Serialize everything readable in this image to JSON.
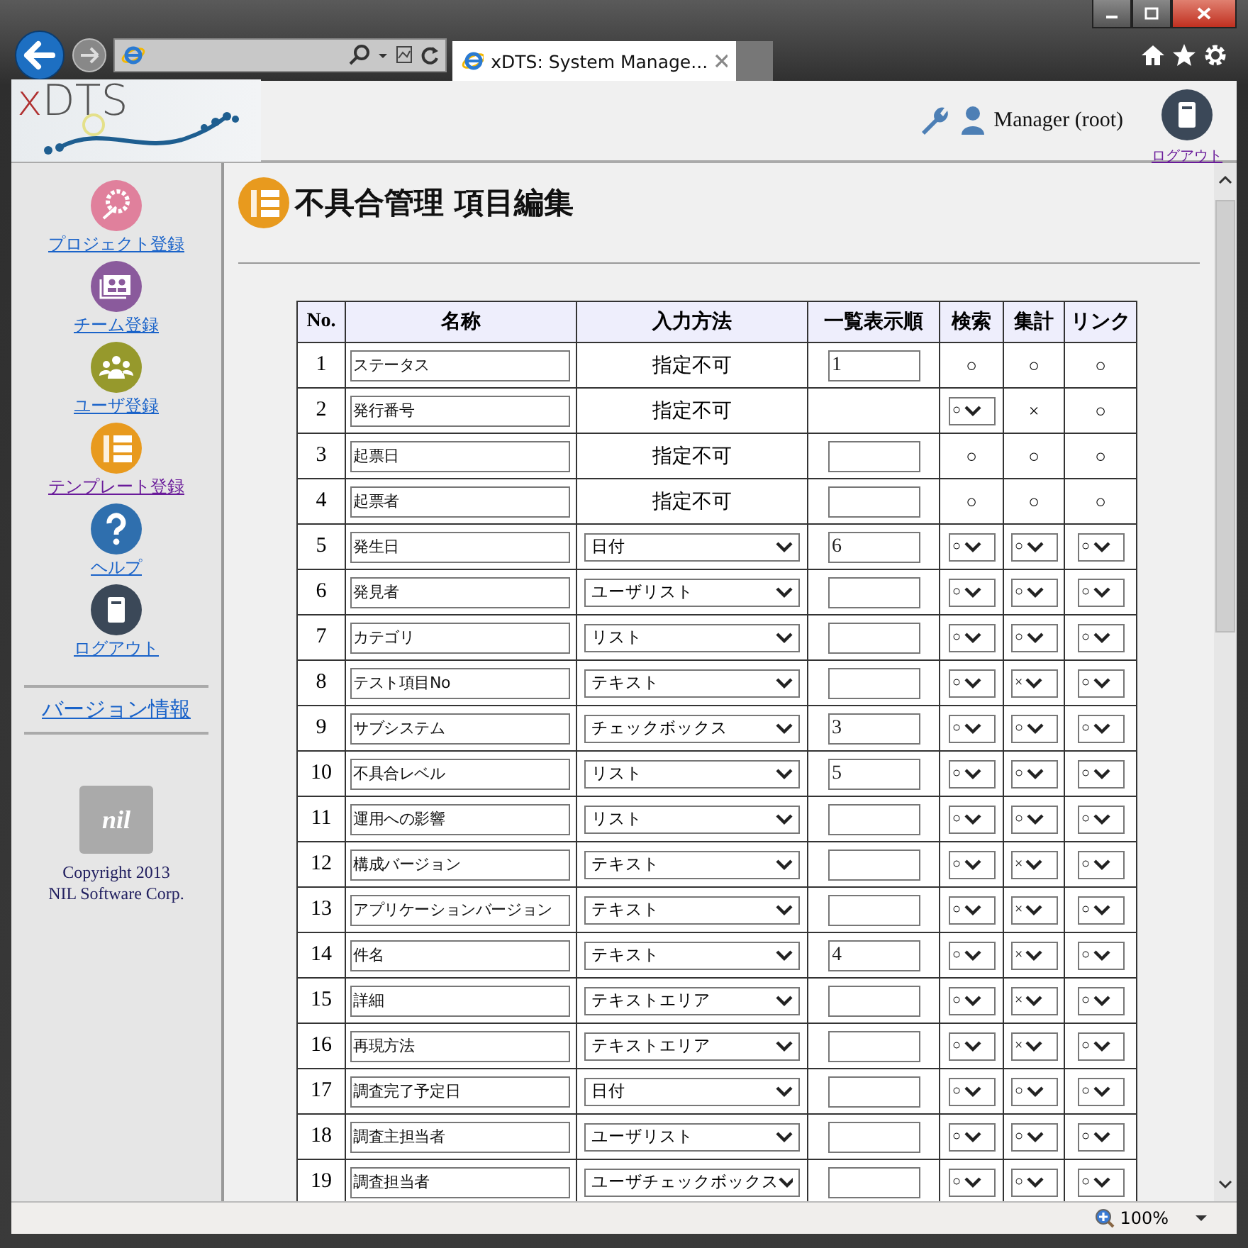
{
  "browser": {
    "tab_title": "xDTS: System Manage...",
    "zoom": "100%"
  },
  "header": {
    "logo_x": "x",
    "logo_rest": "DTS",
    "user": "Manager (root)",
    "logout": "ログアウト"
  },
  "sidebar": {
    "items": [
      {
        "label": "プロジェクト登録",
        "kind": "project",
        "visited": false
      },
      {
        "label": "チーム登録",
        "kind": "team",
        "visited": false
      },
      {
        "label": "ユーザ登録",
        "kind": "users",
        "visited": false
      },
      {
        "label": "テンプレート登録",
        "kind": "template",
        "visited": true
      },
      {
        "label": "ヘルプ",
        "kind": "help",
        "visited": false
      },
      {
        "label": "ログアウト",
        "kind": "logout",
        "visited": false
      }
    ],
    "version_link": "バージョン情報",
    "company_logo": "nil",
    "copyright": [
      "Copyright 2013",
      "NIL Software Corp."
    ]
  },
  "page": {
    "title": "不具合管理 項目編集"
  },
  "table": {
    "columns": [
      "No.",
      "名称",
      "入力方法",
      "一覧表示順",
      "検索",
      "集計",
      "リンク"
    ],
    "rows": [
      {
        "no": "1",
        "name": "ステータス",
        "method": {
          "kind": "fixed",
          "value": "指定不可"
        },
        "order": {
          "kind": "input",
          "value": "1"
        },
        "search": {
          "kind": "mark",
          "value": "○"
        },
        "aggregate": {
          "kind": "mark",
          "value": "○"
        },
        "link": {
          "kind": "mark",
          "value": "○"
        }
      },
      {
        "no": "2",
        "name": "発行番号",
        "method": {
          "kind": "fixed",
          "value": "指定不可"
        },
        "order": {
          "kind": "blank"
        },
        "search": {
          "kind": "select",
          "value": "○"
        },
        "aggregate": {
          "kind": "mark",
          "value": "×"
        },
        "link": {
          "kind": "mark",
          "value": "○"
        }
      },
      {
        "no": "3",
        "name": "起票日",
        "method": {
          "kind": "fixed",
          "value": "指定不可"
        },
        "order": {
          "kind": "input"
        },
        "search": {
          "kind": "mark",
          "value": "○"
        },
        "aggregate": {
          "kind": "mark",
          "value": "○"
        },
        "link": {
          "kind": "mark",
          "value": "○"
        }
      },
      {
        "no": "4",
        "name": "起票者",
        "method": {
          "kind": "fixed",
          "value": "指定不可"
        },
        "order": {
          "kind": "input"
        },
        "search": {
          "kind": "mark",
          "value": "○"
        },
        "aggregate": {
          "kind": "mark",
          "value": "○"
        },
        "link": {
          "kind": "mark",
          "value": "○"
        }
      },
      {
        "no": "5",
        "name": "発生日",
        "method": {
          "kind": "select",
          "value": "日付"
        },
        "order": {
          "kind": "input",
          "value": "6"
        },
        "search": {
          "kind": "select",
          "value": "○"
        },
        "aggregate": {
          "kind": "select",
          "value": "○"
        },
        "link": {
          "kind": "select",
          "value": "○"
        }
      },
      {
        "no": "6",
        "name": "発見者",
        "method": {
          "kind": "select",
          "value": "ユーザリスト"
        },
        "order": {
          "kind": "input"
        },
        "search": {
          "kind": "select",
          "value": "○"
        },
        "aggregate": {
          "kind": "select",
          "value": "○"
        },
        "link": {
          "kind": "select",
          "value": "○"
        }
      },
      {
        "no": "7",
        "name": "カテゴリ",
        "method": {
          "kind": "select",
          "value": "リスト"
        },
        "order": {
          "kind": "input"
        },
        "search": {
          "kind": "select",
          "value": "○"
        },
        "aggregate": {
          "kind": "select",
          "value": "○"
        },
        "link": {
          "kind": "select",
          "value": "○"
        }
      },
      {
        "no": "8",
        "name": "テスト項目No",
        "method": {
          "kind": "select",
          "value": "テキスト"
        },
        "order": {
          "kind": "input"
        },
        "search": {
          "kind": "select",
          "value": "○"
        },
        "aggregate": {
          "kind": "select",
          "value": "×"
        },
        "link": {
          "kind": "select",
          "value": "○"
        }
      },
      {
        "no": "9",
        "name": "サブシステム",
        "method": {
          "kind": "select",
          "value": "チェックボックス"
        },
        "order": {
          "kind": "input",
          "value": "3"
        },
        "search": {
          "kind": "select",
          "value": "○"
        },
        "aggregate": {
          "kind": "select",
          "value": "○"
        },
        "link": {
          "kind": "select",
          "value": "○"
        }
      },
      {
        "no": "10",
        "name": "不具合レベル",
        "method": {
          "kind": "select",
          "value": "リスト"
        },
        "order": {
          "kind": "input",
          "value": "5"
        },
        "search": {
          "kind": "select",
          "value": "○"
        },
        "aggregate": {
          "kind": "select",
          "value": "○"
        },
        "link": {
          "kind": "select",
          "value": "○"
        }
      },
      {
        "no": "11",
        "name": "運用への影響",
        "method": {
          "kind": "select",
          "value": "リスト"
        },
        "order": {
          "kind": "input"
        },
        "search": {
          "kind": "select",
          "value": "○"
        },
        "aggregate": {
          "kind": "select",
          "value": "○"
        },
        "link": {
          "kind": "select",
          "value": "○"
        }
      },
      {
        "no": "12",
        "name": "構成バージョン",
        "method": {
          "kind": "select",
          "value": "テキスト"
        },
        "order": {
          "kind": "input"
        },
        "search": {
          "kind": "select",
          "value": "○"
        },
        "aggregate": {
          "kind": "select",
          "value": "×"
        },
        "link": {
          "kind": "select",
          "value": "○"
        }
      },
      {
        "no": "13",
        "name": "アプリケーションバージョン",
        "method": {
          "kind": "select",
          "value": "テキスト"
        },
        "order": {
          "kind": "input"
        },
        "search": {
          "kind": "select",
          "value": "○"
        },
        "aggregate": {
          "kind": "select",
          "value": "×"
        },
        "link": {
          "kind": "select",
          "value": "○"
        }
      },
      {
        "no": "14",
        "name": "件名",
        "method": {
          "kind": "select",
          "value": "テキスト"
        },
        "order": {
          "kind": "input",
          "value": "4"
        },
        "search": {
          "kind": "select",
          "value": "○"
        },
        "aggregate": {
          "kind": "select",
          "value": "×"
        },
        "link": {
          "kind": "select",
          "value": "○"
        }
      },
      {
        "no": "15",
        "name": "詳細",
        "method": {
          "kind": "select",
          "value": "テキストエリア"
        },
        "order": {
          "kind": "input"
        },
        "search": {
          "kind": "select",
          "value": "○"
        },
        "aggregate": {
          "kind": "select",
          "value": "×"
        },
        "link": {
          "kind": "select",
          "value": "○"
        }
      },
      {
        "no": "16",
        "name": "再現方法",
        "method": {
          "kind": "select",
          "value": "テキストエリア"
        },
        "order": {
          "kind": "input"
        },
        "search": {
          "kind": "select",
          "value": "○"
        },
        "aggregate": {
          "kind": "select",
          "value": "×"
        },
        "link": {
          "kind": "select",
          "value": "○"
        }
      },
      {
        "no": "17",
        "name": "調査完了予定日",
        "method": {
          "kind": "select",
          "value": "日付"
        },
        "order": {
          "kind": "input"
        },
        "search": {
          "kind": "select",
          "value": "○"
        },
        "aggregate": {
          "kind": "select",
          "value": "○"
        },
        "link": {
          "kind": "select",
          "value": "○"
        }
      },
      {
        "no": "18",
        "name": "調査主担当者",
        "method": {
          "kind": "select",
          "value": "ユーザリスト"
        },
        "order": {
          "kind": "input"
        },
        "search": {
          "kind": "select",
          "value": "○"
        },
        "aggregate": {
          "kind": "select",
          "value": "○"
        },
        "link": {
          "kind": "select",
          "value": "○"
        }
      },
      {
        "no": "19",
        "name": "調査担当者",
        "method": {
          "kind": "select",
          "value": "ユーザチェックボックス"
        },
        "order": {
          "kind": "input"
        },
        "search": {
          "kind": "select",
          "value": "○"
        },
        "aggregate": {
          "kind": "select",
          "value": "○"
        },
        "link": {
          "kind": "select",
          "value": "○"
        }
      }
    ]
  }
}
